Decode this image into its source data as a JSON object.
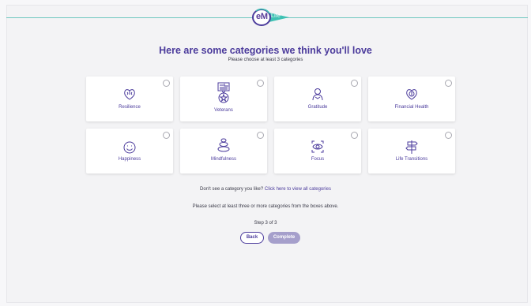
{
  "header": {
    "logo_brand": "eM",
    "logo_suffix": "Life",
    "brand_colors": {
      "purple": "#4b3b9c",
      "teal": "#3ec1b3",
      "rule": "#6fc7c0"
    }
  },
  "main": {
    "title": "Here are some categories we think you'll love",
    "subtitle": "Please choose at least 3 categories",
    "categories": [
      {
        "label": "Resilience",
        "icon": "brain-heart-icon"
      },
      {
        "label": "Veterans",
        "icon": "flag-medal-icon"
      },
      {
        "label": "Gratitude",
        "icon": "person-hands-icon"
      },
      {
        "label": "Financial Health",
        "icon": "heart-dollar-icon"
      },
      {
        "label": "Happiness",
        "icon": "smiley-icon"
      },
      {
        "label": "Mindfulness",
        "icon": "stacked-stones-icon"
      },
      {
        "label": "Focus",
        "icon": "eye-focus-icon"
      },
      {
        "label": "Life Transitions",
        "icon": "signpost-icon"
      }
    ],
    "view_all_prompt": "Don't see a category you like?",
    "view_all_link": "Click here to view all categories",
    "validation_message": "Please select at least three or more categories from the boxes above.",
    "step_text": "Step 3 of 3",
    "back_label": "Back",
    "complete_label": "Complete"
  }
}
